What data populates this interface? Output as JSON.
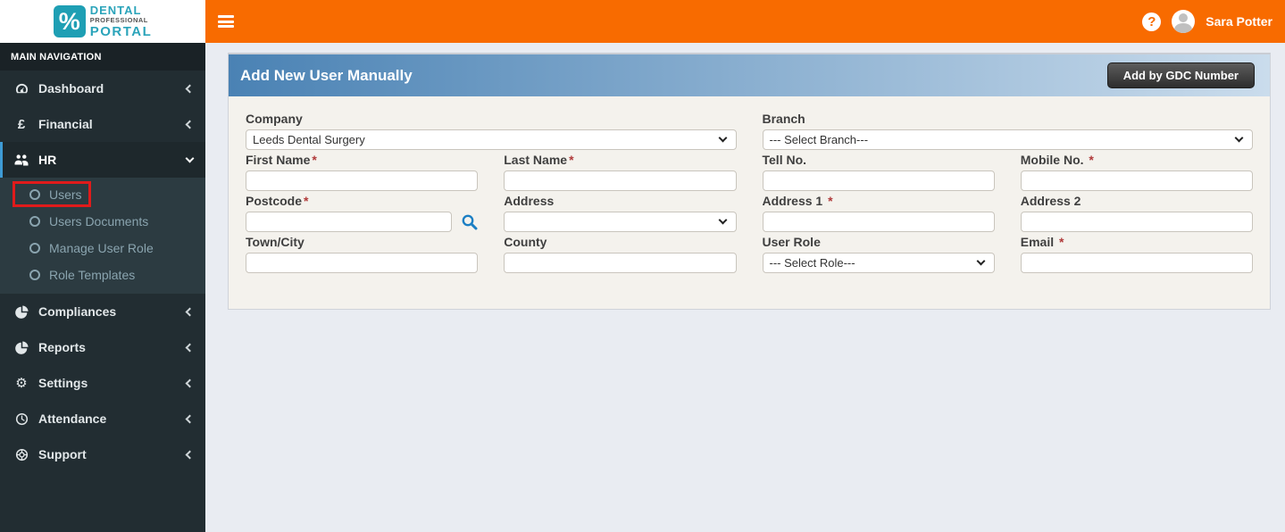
{
  "brand": {
    "icon_glyph": "%",
    "line1": "DENTAL",
    "line2": "PROFESSIONAL",
    "line3": "PORTAL"
  },
  "topbar": {
    "help_glyph": "?",
    "user_name": "Sara Potter"
  },
  "sidebar": {
    "section_label": "MAIN NAVIGATION",
    "items": [
      {
        "label": "Dashboard"
      },
      {
        "label": "Financial",
        "icon_glyph": "£"
      },
      {
        "label": "HR",
        "children": [
          {
            "label": "Users"
          },
          {
            "label": "Users Documents"
          },
          {
            "label": "Manage User Role"
          },
          {
            "label": "Role Templates"
          }
        ]
      },
      {
        "label": "Compliances"
      },
      {
        "label": "Reports"
      },
      {
        "label": "Settings",
        "icon_glyph": "⚙"
      },
      {
        "label": "Attendance"
      },
      {
        "label": "Support"
      }
    ]
  },
  "panel": {
    "title": "Add New User Manually",
    "gdc_button": "Add by GDC Number"
  },
  "form": {
    "required_marker": "*",
    "company": {
      "label": "Company",
      "value": "Leeds Dental Surgery"
    },
    "branch": {
      "label": "Branch",
      "value": "--- Select Branch---"
    },
    "first_name": {
      "label": "First Name"
    },
    "last_name": {
      "label": "Last Name"
    },
    "tell_no": {
      "label": "Tell No."
    },
    "mobile_no": {
      "label": "Mobile No."
    },
    "postcode": {
      "label": "Postcode"
    },
    "address": {
      "label": "Address"
    },
    "address1": {
      "label": "Address 1"
    },
    "address2": {
      "label": "Address 2"
    },
    "town_city": {
      "label": "Town/City"
    },
    "county": {
      "label": "County"
    },
    "user_role": {
      "label": "User Role",
      "value": "--- Select Role---"
    },
    "email": {
      "label": "Email"
    }
  },
  "colors": {
    "topbar_orange": "#f86b00",
    "sidebar_bg": "#222d32",
    "submenu_bg": "#2c3b41",
    "active_accent": "#3e9bd5",
    "panel_header_from": "#4a82b4",
    "panel_header_to": "#cadcec",
    "panel_body_bg": "#f4f2ed",
    "annotation_red": "#e01b1b",
    "search_icon_blue": "#1b7fc4",
    "brand_teal": "#1e9fb4",
    "required_red": "#b03a3a"
  }
}
